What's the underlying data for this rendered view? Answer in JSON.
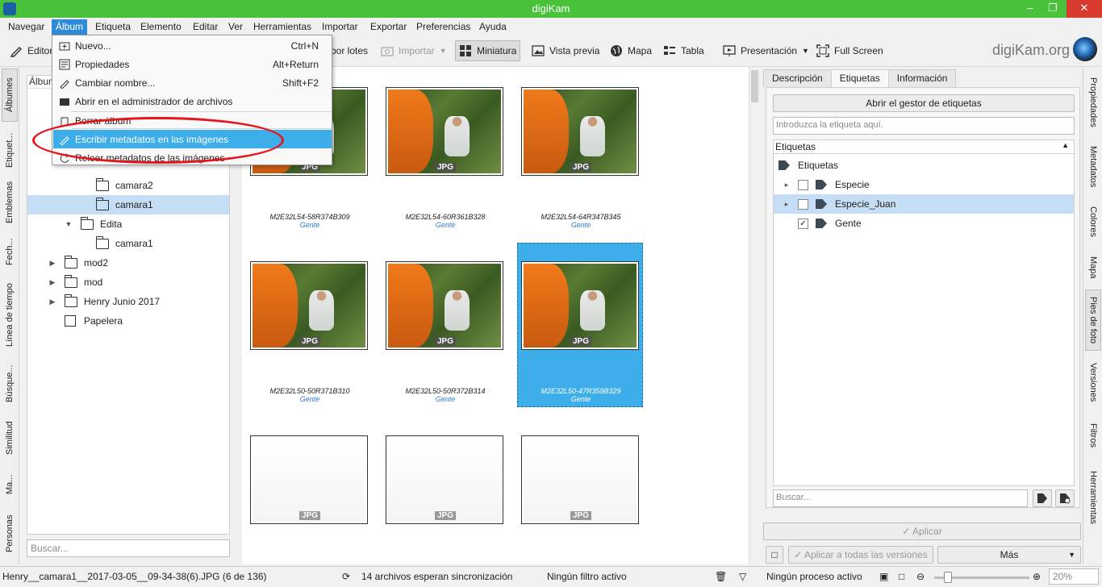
{
  "window": {
    "title": "digiKam"
  },
  "menu": [
    "Navegar",
    "Álbum",
    "Etiqueta",
    "Elemento",
    "Editar",
    "Ver",
    "Herramientas",
    "Importar",
    "Exportar",
    "Preferencias",
    "Ayuda"
  ],
  "toolbar": {
    "editor": "Editor",
    "batch": "por lotes",
    "import": "Importar",
    "thumbnail": "Miniatura",
    "preview": "Vista previa",
    "map": "Mapa",
    "table": "Tabla",
    "slideshow": "Presentación",
    "fullscreen": "Full Screen",
    "brand": "digiKam.org"
  },
  "album_menu": {
    "items": [
      {
        "label": "Nuevo...",
        "shortcut": "Ctrl+N"
      },
      {
        "label": "Propiedades",
        "shortcut": "Alt+Return"
      },
      {
        "label": "Cambiar nombre...",
        "shortcut": "Shift+F2"
      },
      {
        "label": "Abrir en el administrador de archivos",
        "shortcut": ""
      },
      {
        "label": "Borrar álbum",
        "shortcut": ""
      },
      {
        "label": "Escribir metadatos en las imágenes",
        "shortcut": ""
      },
      {
        "label": "Releer metadatos de las imágenes",
        "shortcut": ""
      }
    ]
  },
  "left_tabs": [
    "Álbumes",
    "Etiquet...",
    "Emblemas",
    "Fech...",
    "Línea de tiempo",
    "Búsque...",
    "Similitud",
    "Ma...",
    "Personas"
  ],
  "album_tree": {
    "header": "Álbum",
    "rows": [
      "camara2",
      "camara1",
      "Edita",
      "camara1",
      "mod2",
      "mod",
      "Henry Junio 2017",
      "Papelera"
    ],
    "search_placeholder": "Buscar..."
  },
  "thumbnails": [
    {
      "name": "M2E32L54-58R374B309",
      "tag": "Gente",
      "badge": "JPG"
    },
    {
      "name": "M2E32L54-60R361B328",
      "tag": "Gente",
      "badge": "JPG"
    },
    {
      "name": "M2E32L54-64R347B345",
      "tag": "Gente",
      "badge": "JPG"
    },
    {
      "name": "M2E32L50-50R371B310",
      "tag": "Gente",
      "badge": "JPG"
    },
    {
      "name": "M2E32L50-50R372B314",
      "tag": "Gente",
      "badge": "JPG"
    },
    {
      "name": "M2E32L50-47R359B329",
      "tag": "Gente",
      "badge": "JPG"
    },
    {
      "name": "",
      "tag": "",
      "badge": "JPG"
    },
    {
      "name": "",
      "tag": "",
      "badge": "JPG"
    },
    {
      "name": "",
      "tag": "",
      "badge": "JPG"
    }
  ],
  "right_panel": {
    "tabs": [
      "Descripción",
      "Etiquetas",
      "Información"
    ],
    "open_manager": "Abrir el gestor de etiquetas",
    "tag_input_placeholder": "Introduzca la etiqueta aquí.",
    "tree_header": "Etiquetas",
    "tags": [
      "Etiquetas",
      "Especie",
      "Especie_Juan",
      "Gente"
    ],
    "search_placeholder": "Buscar...",
    "apply": "Aplicar",
    "apply_all": "Aplicar a todas las versiones",
    "more": "Más"
  },
  "right_tabs": [
    "Propiedades",
    "Metadatos",
    "Colores",
    "Mapa",
    "Pies de foto",
    "Versiones",
    "Filtros",
    "Herramientas"
  ],
  "status": {
    "file": "Henry__camara1__2017-03-05__09-34-38(6).JPG (6 de 136)",
    "sync": "14 archivos esperan sincronización",
    "filter": "Ningún filtro activo",
    "process": "Ningún proceso activo",
    "zoom": "20%"
  },
  "colors": {
    "titlebar": "#4ac13a",
    "selection": "#3daee9",
    "annotation": "#e8141c"
  }
}
